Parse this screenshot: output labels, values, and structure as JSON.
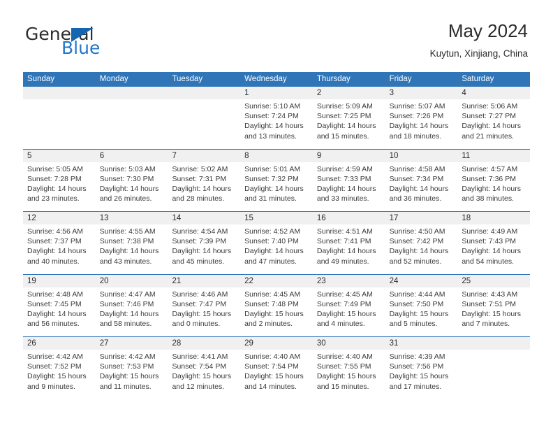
{
  "brand": {
    "name_part1": "General",
    "name_part2": "Blue"
  },
  "header": {
    "title": "May 2024",
    "location": "Kuytun, Xinjiang, China"
  },
  "colors": {
    "header_blue": "#3075b8",
    "brand_blue": "#2277c8",
    "day_band": "#f0f0f0"
  },
  "weekdays": [
    "Sunday",
    "Monday",
    "Tuesday",
    "Wednesday",
    "Thursday",
    "Friday",
    "Saturday"
  ],
  "weeks": [
    [
      {
        "day": "",
        "sunrise": "",
        "sunset": "",
        "daylight_l1": "",
        "daylight_l2": ""
      },
      {
        "day": "",
        "sunrise": "",
        "sunset": "",
        "daylight_l1": "",
        "daylight_l2": ""
      },
      {
        "day": "",
        "sunrise": "",
        "sunset": "",
        "daylight_l1": "",
        "daylight_l2": ""
      },
      {
        "day": "1",
        "sunrise": "Sunrise: 5:10 AM",
        "sunset": "Sunset: 7:24 PM",
        "daylight_l1": "Daylight: 14 hours",
        "daylight_l2": "and 13 minutes."
      },
      {
        "day": "2",
        "sunrise": "Sunrise: 5:09 AM",
        "sunset": "Sunset: 7:25 PM",
        "daylight_l1": "Daylight: 14 hours",
        "daylight_l2": "and 15 minutes."
      },
      {
        "day": "3",
        "sunrise": "Sunrise: 5:07 AM",
        "sunset": "Sunset: 7:26 PM",
        "daylight_l1": "Daylight: 14 hours",
        "daylight_l2": "and 18 minutes."
      },
      {
        "day": "4",
        "sunrise": "Sunrise: 5:06 AM",
        "sunset": "Sunset: 7:27 PM",
        "daylight_l1": "Daylight: 14 hours",
        "daylight_l2": "and 21 minutes."
      }
    ],
    [
      {
        "day": "5",
        "sunrise": "Sunrise: 5:05 AM",
        "sunset": "Sunset: 7:28 PM",
        "daylight_l1": "Daylight: 14 hours",
        "daylight_l2": "and 23 minutes."
      },
      {
        "day": "6",
        "sunrise": "Sunrise: 5:03 AM",
        "sunset": "Sunset: 7:30 PM",
        "daylight_l1": "Daylight: 14 hours",
        "daylight_l2": "and 26 minutes."
      },
      {
        "day": "7",
        "sunrise": "Sunrise: 5:02 AM",
        "sunset": "Sunset: 7:31 PM",
        "daylight_l1": "Daylight: 14 hours",
        "daylight_l2": "and 28 minutes."
      },
      {
        "day": "8",
        "sunrise": "Sunrise: 5:01 AM",
        "sunset": "Sunset: 7:32 PM",
        "daylight_l1": "Daylight: 14 hours",
        "daylight_l2": "and 31 minutes."
      },
      {
        "day": "9",
        "sunrise": "Sunrise: 4:59 AM",
        "sunset": "Sunset: 7:33 PM",
        "daylight_l1": "Daylight: 14 hours",
        "daylight_l2": "and 33 minutes."
      },
      {
        "day": "10",
        "sunrise": "Sunrise: 4:58 AM",
        "sunset": "Sunset: 7:34 PM",
        "daylight_l1": "Daylight: 14 hours",
        "daylight_l2": "and 36 minutes."
      },
      {
        "day": "11",
        "sunrise": "Sunrise: 4:57 AM",
        "sunset": "Sunset: 7:36 PM",
        "daylight_l1": "Daylight: 14 hours",
        "daylight_l2": "and 38 minutes."
      }
    ],
    [
      {
        "day": "12",
        "sunrise": "Sunrise: 4:56 AM",
        "sunset": "Sunset: 7:37 PM",
        "daylight_l1": "Daylight: 14 hours",
        "daylight_l2": "and 40 minutes."
      },
      {
        "day": "13",
        "sunrise": "Sunrise: 4:55 AM",
        "sunset": "Sunset: 7:38 PM",
        "daylight_l1": "Daylight: 14 hours",
        "daylight_l2": "and 43 minutes."
      },
      {
        "day": "14",
        "sunrise": "Sunrise: 4:54 AM",
        "sunset": "Sunset: 7:39 PM",
        "daylight_l1": "Daylight: 14 hours",
        "daylight_l2": "and 45 minutes."
      },
      {
        "day": "15",
        "sunrise": "Sunrise: 4:52 AM",
        "sunset": "Sunset: 7:40 PM",
        "daylight_l1": "Daylight: 14 hours",
        "daylight_l2": "and 47 minutes."
      },
      {
        "day": "16",
        "sunrise": "Sunrise: 4:51 AM",
        "sunset": "Sunset: 7:41 PM",
        "daylight_l1": "Daylight: 14 hours",
        "daylight_l2": "and 49 minutes."
      },
      {
        "day": "17",
        "sunrise": "Sunrise: 4:50 AM",
        "sunset": "Sunset: 7:42 PM",
        "daylight_l1": "Daylight: 14 hours",
        "daylight_l2": "and 52 minutes."
      },
      {
        "day": "18",
        "sunrise": "Sunrise: 4:49 AM",
        "sunset": "Sunset: 7:43 PM",
        "daylight_l1": "Daylight: 14 hours",
        "daylight_l2": "and 54 minutes."
      }
    ],
    [
      {
        "day": "19",
        "sunrise": "Sunrise: 4:48 AM",
        "sunset": "Sunset: 7:45 PM",
        "daylight_l1": "Daylight: 14 hours",
        "daylight_l2": "and 56 minutes."
      },
      {
        "day": "20",
        "sunrise": "Sunrise: 4:47 AM",
        "sunset": "Sunset: 7:46 PM",
        "daylight_l1": "Daylight: 14 hours",
        "daylight_l2": "and 58 minutes."
      },
      {
        "day": "21",
        "sunrise": "Sunrise: 4:46 AM",
        "sunset": "Sunset: 7:47 PM",
        "daylight_l1": "Daylight: 15 hours",
        "daylight_l2": "and 0 minutes."
      },
      {
        "day": "22",
        "sunrise": "Sunrise: 4:45 AM",
        "sunset": "Sunset: 7:48 PM",
        "daylight_l1": "Daylight: 15 hours",
        "daylight_l2": "and 2 minutes."
      },
      {
        "day": "23",
        "sunrise": "Sunrise: 4:45 AM",
        "sunset": "Sunset: 7:49 PM",
        "daylight_l1": "Daylight: 15 hours",
        "daylight_l2": "and 4 minutes."
      },
      {
        "day": "24",
        "sunrise": "Sunrise: 4:44 AM",
        "sunset": "Sunset: 7:50 PM",
        "daylight_l1": "Daylight: 15 hours",
        "daylight_l2": "and 5 minutes."
      },
      {
        "day": "25",
        "sunrise": "Sunrise: 4:43 AM",
        "sunset": "Sunset: 7:51 PM",
        "daylight_l1": "Daylight: 15 hours",
        "daylight_l2": "and 7 minutes."
      }
    ],
    [
      {
        "day": "26",
        "sunrise": "Sunrise: 4:42 AM",
        "sunset": "Sunset: 7:52 PM",
        "daylight_l1": "Daylight: 15 hours",
        "daylight_l2": "and 9 minutes."
      },
      {
        "day": "27",
        "sunrise": "Sunrise: 4:42 AM",
        "sunset": "Sunset: 7:53 PM",
        "daylight_l1": "Daylight: 15 hours",
        "daylight_l2": "and 11 minutes."
      },
      {
        "day": "28",
        "sunrise": "Sunrise: 4:41 AM",
        "sunset": "Sunset: 7:54 PM",
        "daylight_l1": "Daylight: 15 hours",
        "daylight_l2": "and 12 minutes."
      },
      {
        "day": "29",
        "sunrise": "Sunrise: 4:40 AM",
        "sunset": "Sunset: 7:54 PM",
        "daylight_l1": "Daylight: 15 hours",
        "daylight_l2": "and 14 minutes."
      },
      {
        "day": "30",
        "sunrise": "Sunrise: 4:40 AM",
        "sunset": "Sunset: 7:55 PM",
        "daylight_l1": "Daylight: 15 hours",
        "daylight_l2": "and 15 minutes."
      },
      {
        "day": "31",
        "sunrise": "Sunrise: 4:39 AM",
        "sunset": "Sunset: 7:56 PM",
        "daylight_l1": "Daylight: 15 hours",
        "daylight_l2": "and 17 minutes."
      },
      {
        "day": "",
        "sunrise": "",
        "sunset": "",
        "daylight_l1": "",
        "daylight_l2": ""
      }
    ]
  ]
}
